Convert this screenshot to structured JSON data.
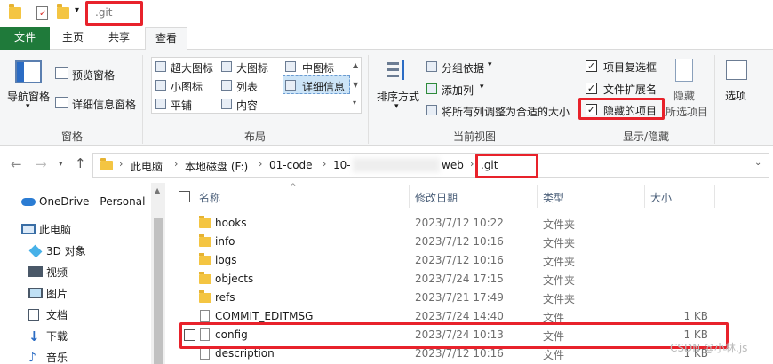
{
  "titlebar": {
    "path_text": ".git"
  },
  "tabs": {
    "file": "文件",
    "home": "主页",
    "share": "共享",
    "view": "查看"
  },
  "ribbon": {
    "pane_group": {
      "nav_pane": "导航窗格",
      "preview_pane": "预览窗格",
      "details_pane": "详细信息窗格",
      "label": "窗格"
    },
    "layout_group": {
      "items": [
        "超大图标",
        "大图标",
        "中图标",
        "小图标",
        "列表",
        "详细信息",
        "平铺",
        "内容"
      ],
      "selected": "详细信息",
      "label": "布局"
    },
    "view_group": {
      "sort_by": "排序方式",
      "group_by": "分组依据",
      "add_columns": "添加列",
      "size_all_columns": "将所有列调整为合适的大小",
      "label": "当前视图"
    },
    "showhide_group": {
      "item_checkboxes": "项目复选框",
      "file_extensions": "文件扩展名",
      "hidden_items": "隐藏的项目",
      "hide_selected_line1": "隐藏",
      "hide_selected_line2": "所选项目",
      "options": "选项",
      "label": "显示/隐藏"
    }
  },
  "address": {
    "crumbs": [
      "此电脑",
      "本地磁盘 (F:)",
      "01-code",
      "10-",
      "web",
      ".git"
    ]
  },
  "nav": {
    "items": [
      "OneDrive - Personal",
      "此电脑",
      "3D 对象",
      "视频",
      "图片",
      "文档",
      "下载",
      "音乐"
    ]
  },
  "columns": {
    "name": "名称",
    "date": "修改日期",
    "type": "类型",
    "size": "大小"
  },
  "files": [
    {
      "name": "hooks",
      "date": "2023/7/12 10:22",
      "type": "文件夹",
      "size": "",
      "kind": "folder"
    },
    {
      "name": "info",
      "date": "2023/7/12 10:16",
      "type": "文件夹",
      "size": "",
      "kind": "folder"
    },
    {
      "name": "logs",
      "date": "2023/7/12 10:16",
      "type": "文件夹",
      "size": "",
      "kind": "folder"
    },
    {
      "name": "objects",
      "date": "2023/7/24 17:15",
      "type": "文件夹",
      "size": "",
      "kind": "folder"
    },
    {
      "name": "refs",
      "date": "2023/7/21 17:49",
      "type": "文件夹",
      "size": "",
      "kind": "folder"
    },
    {
      "name": "COMMIT_EDITMSG",
      "date": "2023/7/24 14:40",
      "type": "文件",
      "size": "1 KB",
      "kind": "file"
    },
    {
      "name": "config",
      "date": "2023/7/24 10:13",
      "type": "文件",
      "size": "1 KB",
      "kind": "file"
    },
    {
      "name": "description",
      "date": "2023/7/12 10:16",
      "type": "文件",
      "size": "1 KB",
      "kind": "file"
    }
  ],
  "watermark": "CSDN @小林.js",
  "colors": {
    "highlight_box": "#e8222b",
    "file_tab": "#1f7a3a",
    "folder": "#f4c542"
  }
}
